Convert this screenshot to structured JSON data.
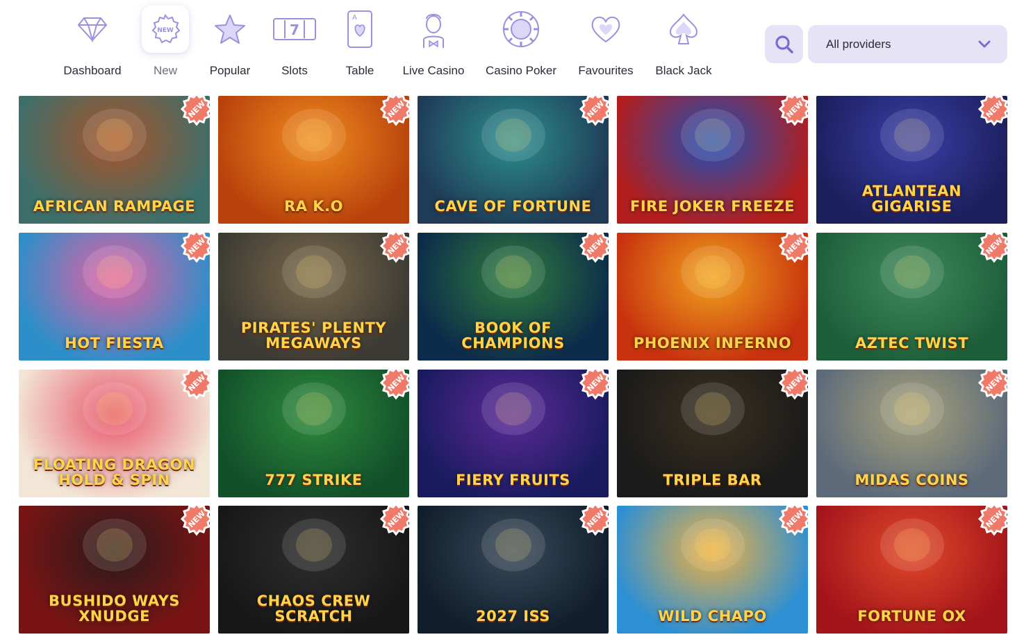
{
  "nav": {
    "categories": [
      {
        "label": "Dashboard",
        "icon": "diamond-icon"
      },
      {
        "label": "New",
        "icon": "new-badge-icon"
      },
      {
        "label": "Popular",
        "icon": "star-icon"
      },
      {
        "label": "Slots",
        "icon": "slot-machine-icon"
      },
      {
        "label": "Table",
        "icon": "playing-card-icon"
      },
      {
        "label": "Live Casino",
        "icon": "dealer-icon"
      },
      {
        "label": "Casino Poker",
        "icon": "poker-chip-icon"
      },
      {
        "label": "Favourites",
        "icon": "heart-icon"
      },
      {
        "label": "Black Jack",
        "icon": "spade-icon"
      }
    ],
    "active": "New",
    "provider_select": {
      "value": "All providers"
    }
  },
  "badge_label": "NEW",
  "colors": {
    "accent": "#8b7ad6",
    "badge": "#f07a6a",
    "select_bg": "#e6e3f6"
  },
  "games": [
    {
      "title": "AFRICAN RAMPAGE",
      "bg": "#3d6f6a",
      "bg2": "#a8532a"
    },
    {
      "title": "RA K.O",
      "bg": "#b8420c",
      "bg2": "#f08c1e"
    },
    {
      "title": "CAVE OF FORTUNE",
      "bg": "#1f3b56",
      "bg2": "#2d8f8f"
    },
    {
      "title": "FIRE JOKER FREEZE",
      "bg": "#b21e1e",
      "bg2": "#1d4fb8"
    },
    {
      "title": "ATLANTEAN GIGARISE",
      "bg": "#1b1f5c",
      "bg2": "#3a3fa8"
    },
    {
      "title": "HOT FIESTA",
      "bg": "#2c8fc9",
      "bg2": "#e85fa3"
    },
    {
      "title": "PIRATES' PLENTY MEGAWAYS",
      "bg": "#3c3a34",
      "bg2": "#7a6a4a"
    },
    {
      "title": "BOOK OF CHAMPIONS",
      "bg": "#0c2b4a",
      "bg2": "#2f7d3e"
    },
    {
      "title": "PHOENIX INFERNO",
      "bg": "#c8320e",
      "bg2": "#f0a21e"
    },
    {
      "title": "AZTEC TWIST",
      "bg": "#1d5e3a",
      "bg2": "#3f8a5a"
    },
    {
      "title": "FLOATING DRAGON HOLD & SPIN",
      "bg": "#f2e6d6",
      "bg2": "#e8556a"
    },
    {
      "title": "777 STRIKE",
      "bg": "#12502a",
      "bg2": "#2f8a3d"
    },
    {
      "title": "FIERY FRUITS",
      "bg": "#1a1b5e",
      "bg2": "#5b2a98"
    },
    {
      "title": "TRIPLE BAR",
      "bg": "#1a1a1a",
      "bg2": "#3a3020"
    },
    {
      "title": "MIDAS COINS",
      "bg": "#5d6a7a",
      "bg2": "#a8a27a"
    },
    {
      "title": "BUSHIDO WAYS xNUDGE",
      "bg": "#7a1414",
      "bg2": "#2a1a1a"
    },
    {
      "title": "CHAOS CREW SCRATCH",
      "bg": "#171717",
      "bg2": "#2e2e2e"
    },
    {
      "title": "2027 ISS",
      "bg": "#0f1d2c",
      "bg2": "#3a4a5a"
    },
    {
      "title": "WILD CHAPO",
      "bg": "#2d8fd4",
      "bg2": "#f0b040"
    },
    {
      "title": "FORTUNE OX",
      "bg": "#a5141a",
      "bg2": "#e04a2a"
    }
  ]
}
